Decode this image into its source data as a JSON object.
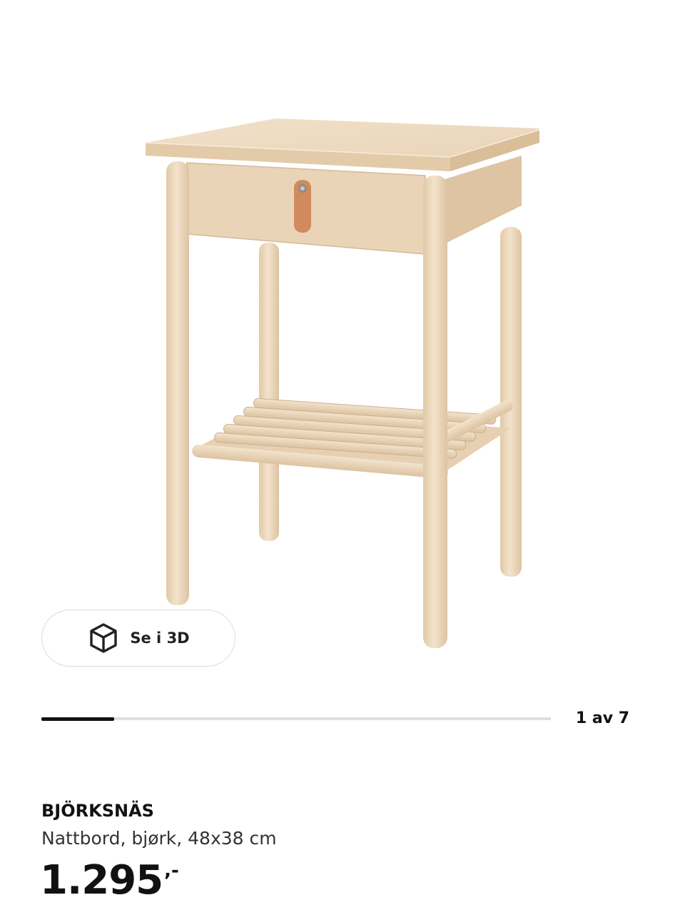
{
  "product": {
    "image_alt": "BJÖRKSNÄS nattbord",
    "name": "BJÖRKSNÄS",
    "description": "Nattbord, bjørk, 48x38 cm",
    "price": {
      "amount": "1.295",
      "suffix": ",-"
    }
  },
  "view_3d": {
    "label": "Se i 3D",
    "icon": "cube-icon"
  },
  "gallery": {
    "counter": "1 av 7",
    "current": 1,
    "total": 7
  },
  "colors": {
    "wood_light": "#EEDCC3",
    "wood_mid": "#E6CFB2",
    "wood_dark": "#D8BE9C",
    "leather": "#D08A5C",
    "text": "#111111",
    "border": "#DCDCDC",
    "track": "#DFDFDF"
  }
}
